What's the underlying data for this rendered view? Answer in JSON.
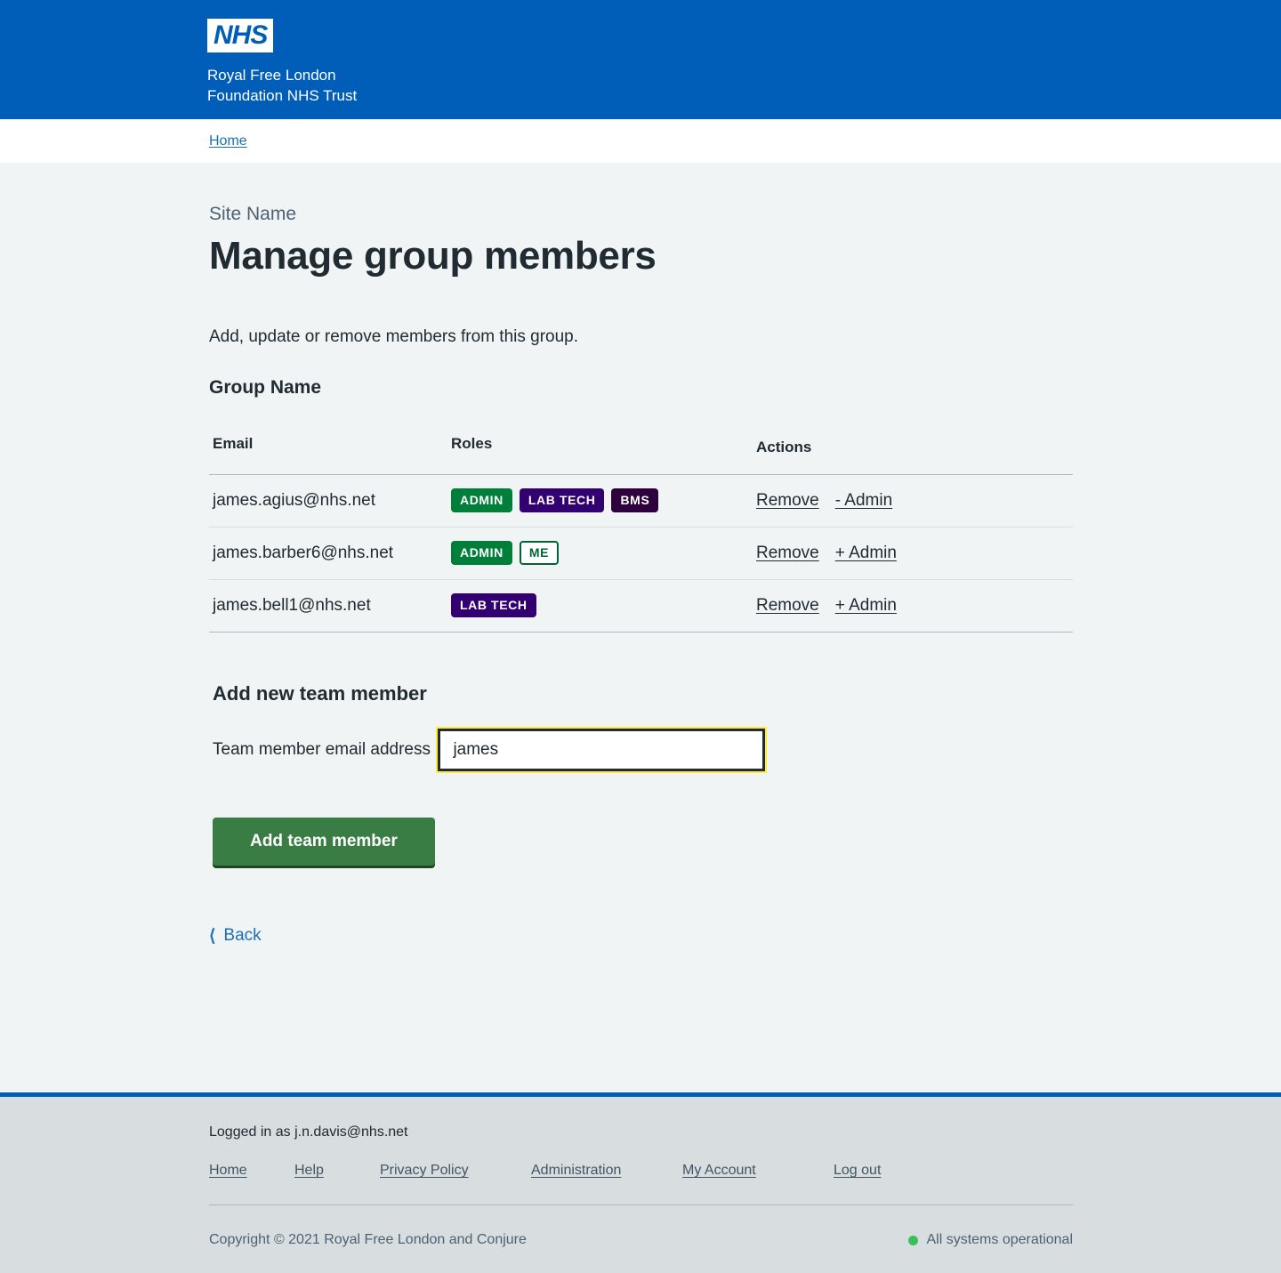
{
  "header": {
    "logo_text": "NHS",
    "org_line1": "Royal Free London",
    "org_line2": "Foundation NHS Trust",
    "brand_color": "#005eb8"
  },
  "breadcrumb": {
    "home_label": "Home"
  },
  "main": {
    "caption": "Site Name",
    "title": "Manage group members",
    "lede": "Add, update or remove members from this group.",
    "group_name_heading": "Group Name"
  },
  "table": {
    "headers": {
      "email": "Email",
      "roles": "Roles",
      "actions": "Actions"
    },
    "rows": [
      {
        "email": "james.agius@nhs.net",
        "tags": [
          {
            "label": "ADMIN",
            "style": "admin"
          },
          {
            "label": "LAB TECH",
            "style": "labtech"
          },
          {
            "label": "BMS",
            "style": "bms"
          }
        ],
        "actions": [
          {
            "label": "Remove",
            "name": "remove-link"
          },
          {
            "label": "- Admin",
            "name": "demote-admin-link"
          }
        ]
      },
      {
        "email": "james.barber6@nhs.net",
        "tags": [
          {
            "label": "ADMIN",
            "style": "admin"
          },
          {
            "label": "ME",
            "style": "me"
          }
        ],
        "actions": [
          {
            "label": "Remove",
            "name": "remove-link"
          },
          {
            "label": "+ Admin",
            "name": "promote-admin-link"
          }
        ]
      },
      {
        "email": "james.bell1@nhs.net",
        "tags": [
          {
            "label": "LAB TECH",
            "style": "labtech"
          }
        ],
        "actions": [
          {
            "label": "Remove",
            "name": "remove-link"
          },
          {
            "label": "+ Admin",
            "name": "promote-admin-link"
          }
        ]
      }
    ]
  },
  "add_member": {
    "heading": "Add new team member",
    "field_label": "Team member email address",
    "input_value": "james",
    "input_placeholder": "",
    "button_label": "Add team member",
    "button_color": "#3a7d44"
  },
  "back": {
    "icon": "chevron-left-icon",
    "label": "Back"
  },
  "footer": {
    "logged_in": "Logged in as j.n.davis@nhs.net",
    "nav": [
      {
        "label": "Home",
        "name": "footer-link-home",
        "wide": false
      },
      {
        "label": "Help",
        "name": "footer-link-help",
        "wide": false
      },
      {
        "label": "Privacy Policy",
        "name": "footer-link-privacy-policy",
        "wide": true
      },
      {
        "label": "Administration",
        "name": "footer-link-administration",
        "wide": true
      },
      {
        "label": "My Account",
        "name": "footer-link-my-account",
        "wide": true
      },
      {
        "label": "Log out",
        "name": "footer-link-log-out",
        "wide": false
      }
    ],
    "copyright": "Copyright © 2021 Royal Free London and Conjure",
    "status_text": "All systems operational",
    "status_color": "#38c15b"
  }
}
